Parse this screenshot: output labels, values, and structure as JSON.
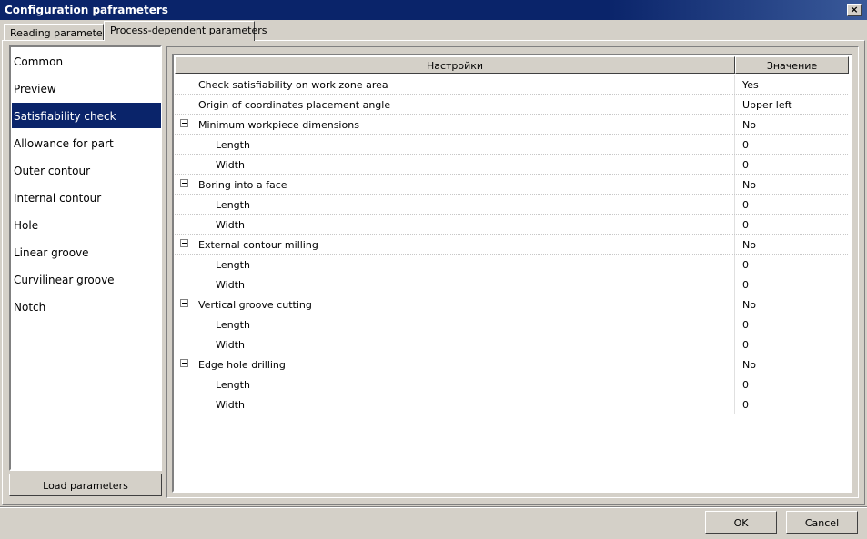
{
  "window": {
    "title": "Configuration paframeters",
    "close_glyph": "×"
  },
  "tabs": [
    {
      "label": "Reading parameters",
      "active": false
    },
    {
      "label": "Process-dependent parameters",
      "active": true
    }
  ],
  "sidebar": {
    "items": [
      {
        "label": "Common",
        "selected": false
      },
      {
        "label": "Preview",
        "selected": false
      },
      {
        "label": "Satisfiability check",
        "selected": true
      },
      {
        "label": "Allowance for part",
        "selected": false
      },
      {
        "label": "Outer contour",
        "selected": false
      },
      {
        "label": "Internal contour",
        "selected": false
      },
      {
        "label": "Hole",
        "selected": false
      },
      {
        "label": "Linear groove",
        "selected": false
      },
      {
        "label": "Curvilinear groove",
        "selected": false
      },
      {
        "label": "Notch",
        "selected": false
      }
    ],
    "load_button": "Load parameters"
  },
  "grid": {
    "columns": {
      "name": "Настройки",
      "value": "Значение"
    },
    "rows": [
      {
        "name": "Check satisfiability on work zone area",
        "value": "Yes",
        "level": 0,
        "expandable": false
      },
      {
        "name": "Origin of coordinates placement angle",
        "value": "Upper left",
        "level": 0,
        "expandable": false
      },
      {
        "name": "Minimum workpiece dimensions",
        "value": "No",
        "level": 0,
        "expandable": true
      },
      {
        "name": "Length",
        "value": "0",
        "level": 1,
        "expandable": false
      },
      {
        "name": "Width",
        "value": "0",
        "level": 1,
        "expandable": false
      },
      {
        "name": "Boring into a face",
        "value": "No",
        "level": 0,
        "expandable": true
      },
      {
        "name": "Length",
        "value": "0",
        "level": 1,
        "expandable": false
      },
      {
        "name": "Width",
        "value": "0",
        "level": 1,
        "expandable": false
      },
      {
        "name": "External contour milling",
        "value": "No",
        "level": 0,
        "expandable": true
      },
      {
        "name": "Length",
        "value": "0",
        "level": 1,
        "expandable": false
      },
      {
        "name": "Width",
        "value": "0",
        "level": 1,
        "expandable": false
      },
      {
        "name": "Vertical groove cutting",
        "value": "No",
        "level": 0,
        "expandable": true
      },
      {
        "name": "Length",
        "value": "0",
        "level": 1,
        "expandable": false
      },
      {
        "name": "Width",
        "value": "0",
        "level": 1,
        "expandable": false
      },
      {
        "name": "Edge hole drilling",
        "value": "No",
        "level": 0,
        "expandable": true
      },
      {
        "name": "Length",
        "value": "0",
        "level": 1,
        "expandable": false
      },
      {
        "name": "Width",
        "value": "0",
        "level": 1,
        "expandable": false
      }
    ]
  },
  "footer": {
    "ok": "OK",
    "cancel": "Cancel"
  },
  "colors": {
    "selection": "#0a246a",
    "face": "#d4d0c8"
  }
}
